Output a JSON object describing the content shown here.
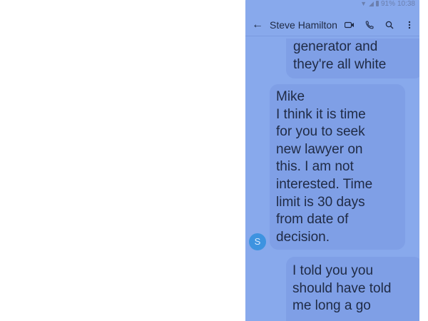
{
  "status_bar": {
    "time": "10:38",
    "battery_text": "91%"
  },
  "app_bar": {
    "back_icon": "arrow-left-icon",
    "contact_name": "Steve Hamilton",
    "actions": [
      "video-call-icon",
      "phone-icon",
      "search-icon",
      "more-vert-icon"
    ]
  },
  "messages": [
    {
      "text": "generator and\nthey're all white"
    },
    {
      "text": "Mike\nI think it is time\nfor you to seek\nnew lawyer on\nthis.  I am not\ninterested.  Time\nlimit is 30 days\nfrom date of\ndecision."
    },
    {
      "text": "I told you you\nshould have told\nme long a go"
    }
  ],
  "avatar_initial": "S",
  "colors": {
    "overlay": "#88a9ec",
    "bubble": "#7f9fe6",
    "avatar": "#3d93e0"
  }
}
